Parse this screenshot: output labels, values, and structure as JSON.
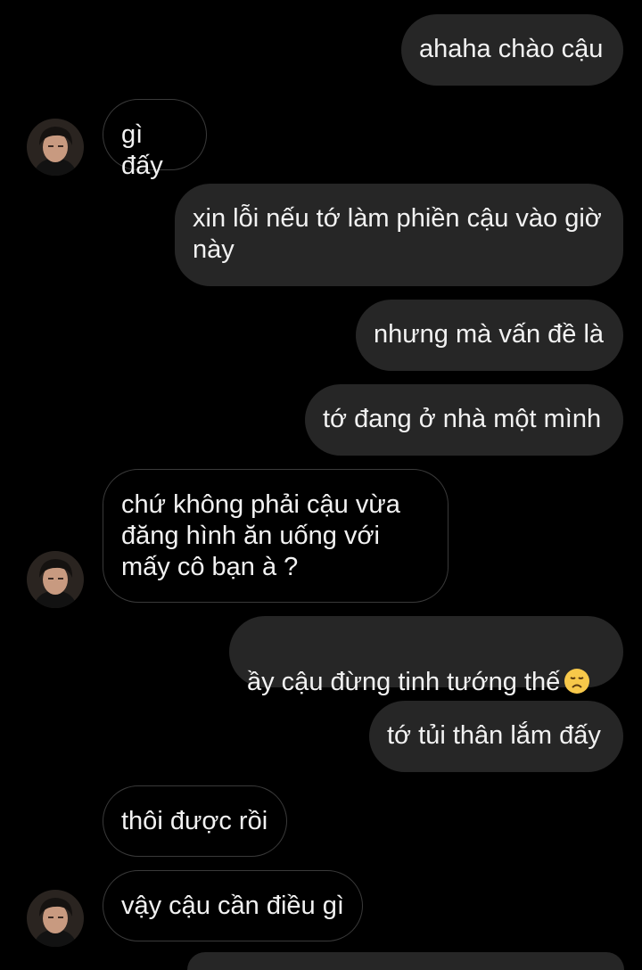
{
  "messages": [
    {
      "from": "me",
      "text": "ahaha chào cậu"
    },
    {
      "from": "them",
      "text": "gì đấy"
    },
    {
      "from": "me",
      "text": "xin lỗi nếu tớ làm phiền cậu vào giờ\nnày"
    },
    {
      "from": "me",
      "text": "nhưng mà vấn đề là"
    },
    {
      "from": "me",
      "text": "tớ đang ở nhà một mình"
    },
    {
      "from": "them",
      "text": "chứ không phải cậu vừa\nđăng hình ăn uống với\nmấy cô bạn à ?"
    },
    {
      "from": "me",
      "text": "ầy cậu đừng tinh tướng thế",
      "emoji": "disappointed-face-icon"
    },
    {
      "from": "me",
      "text": "tớ tủi thân lắm đấy"
    },
    {
      "from": "them",
      "text": "thôi được rồi"
    },
    {
      "from": "them",
      "text": "vậy cậu cần điều gì"
    }
  ],
  "colors": {
    "background": "#000000",
    "outgoing_bubble": "#262626",
    "incoming_border": "#3a3a3a",
    "text": "#f2f2f2"
  }
}
